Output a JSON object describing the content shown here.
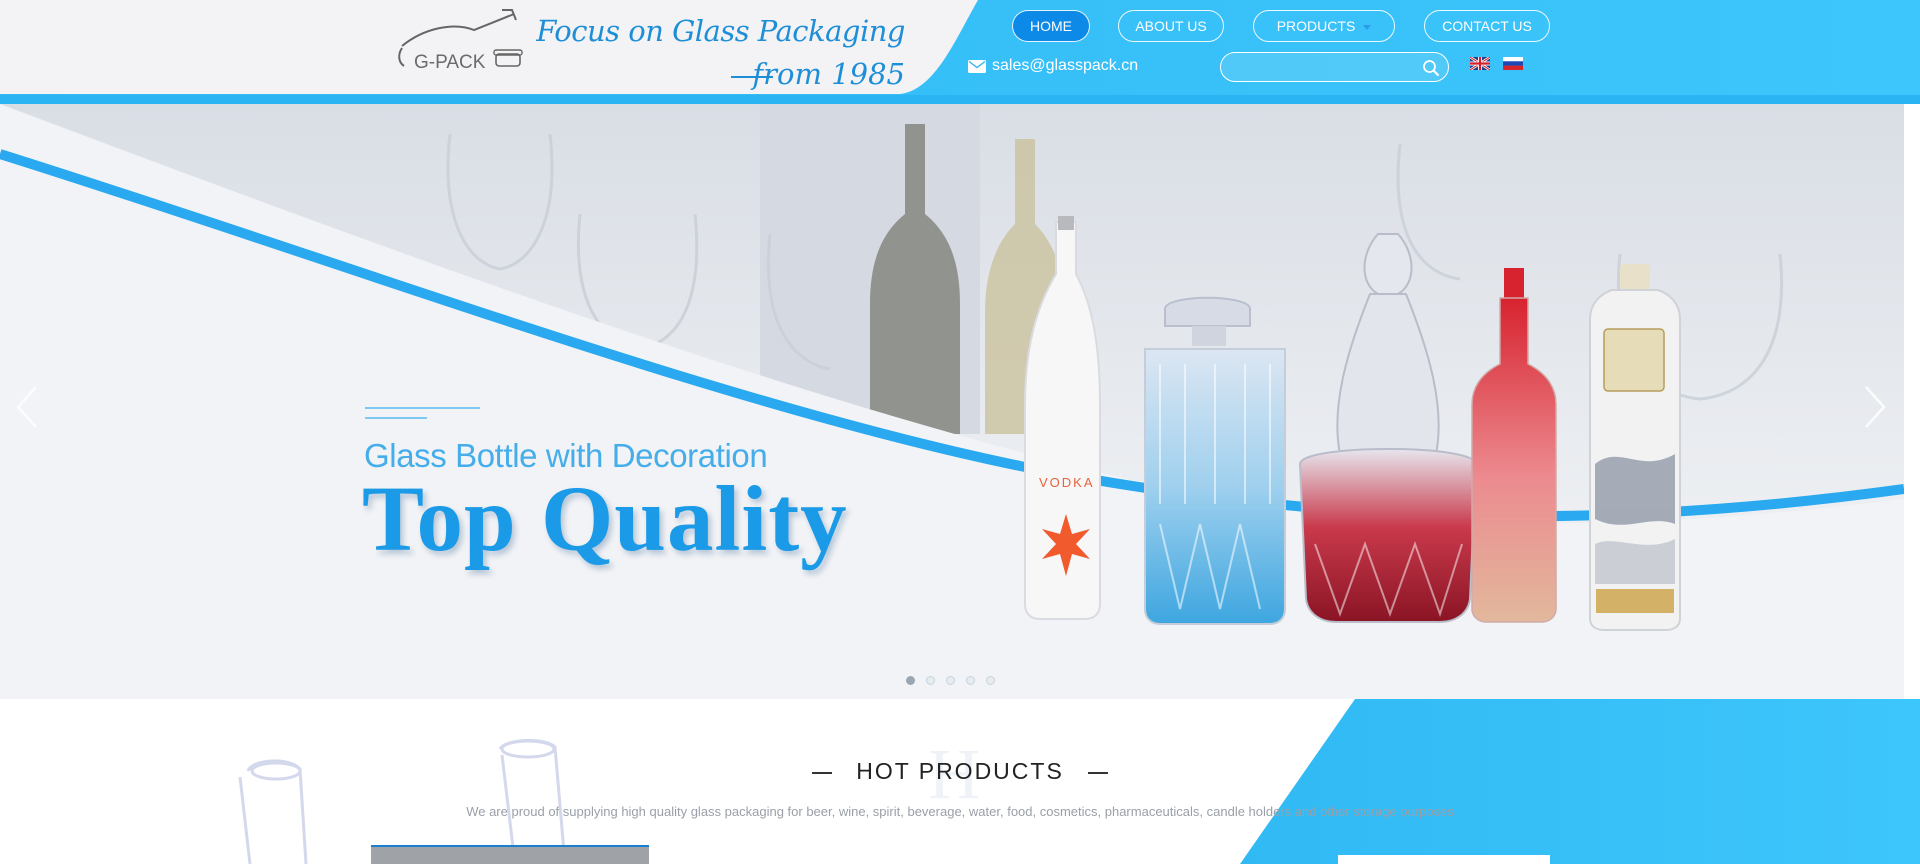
{
  "header": {
    "logo_text": "G-PACK",
    "tagline_line1": "Focus on Glass Packaging",
    "tagline_line2": "from 1985",
    "email": "sales@glasspack.cn",
    "search_placeholder": "",
    "colors": {
      "accent": "#29b6f6",
      "nav_active": "#0d8ae8",
      "tagline": "#1e8fd6"
    }
  },
  "nav": {
    "home": "HOME",
    "about": "ABOUT US",
    "products": "PRODUCTS",
    "contact": "CONTACT US"
  },
  "languages": [
    "uk-flag-icon",
    "russia-flag-icon"
  ],
  "hero": {
    "subtitle": "Glass Bottle with Decoration",
    "title": "Top Quality",
    "bottle_label": "VODKA",
    "slides_count": 5,
    "active_slide": 1
  },
  "hot_products": {
    "title": "HOT PRODUCTS",
    "watermark": "H",
    "description": "We are proud of supplying high quality glass packaging for beer, wine, spirit, beverage, water, food, cosmetics, pharmaceuticals, candle holders and other storage purposes"
  }
}
